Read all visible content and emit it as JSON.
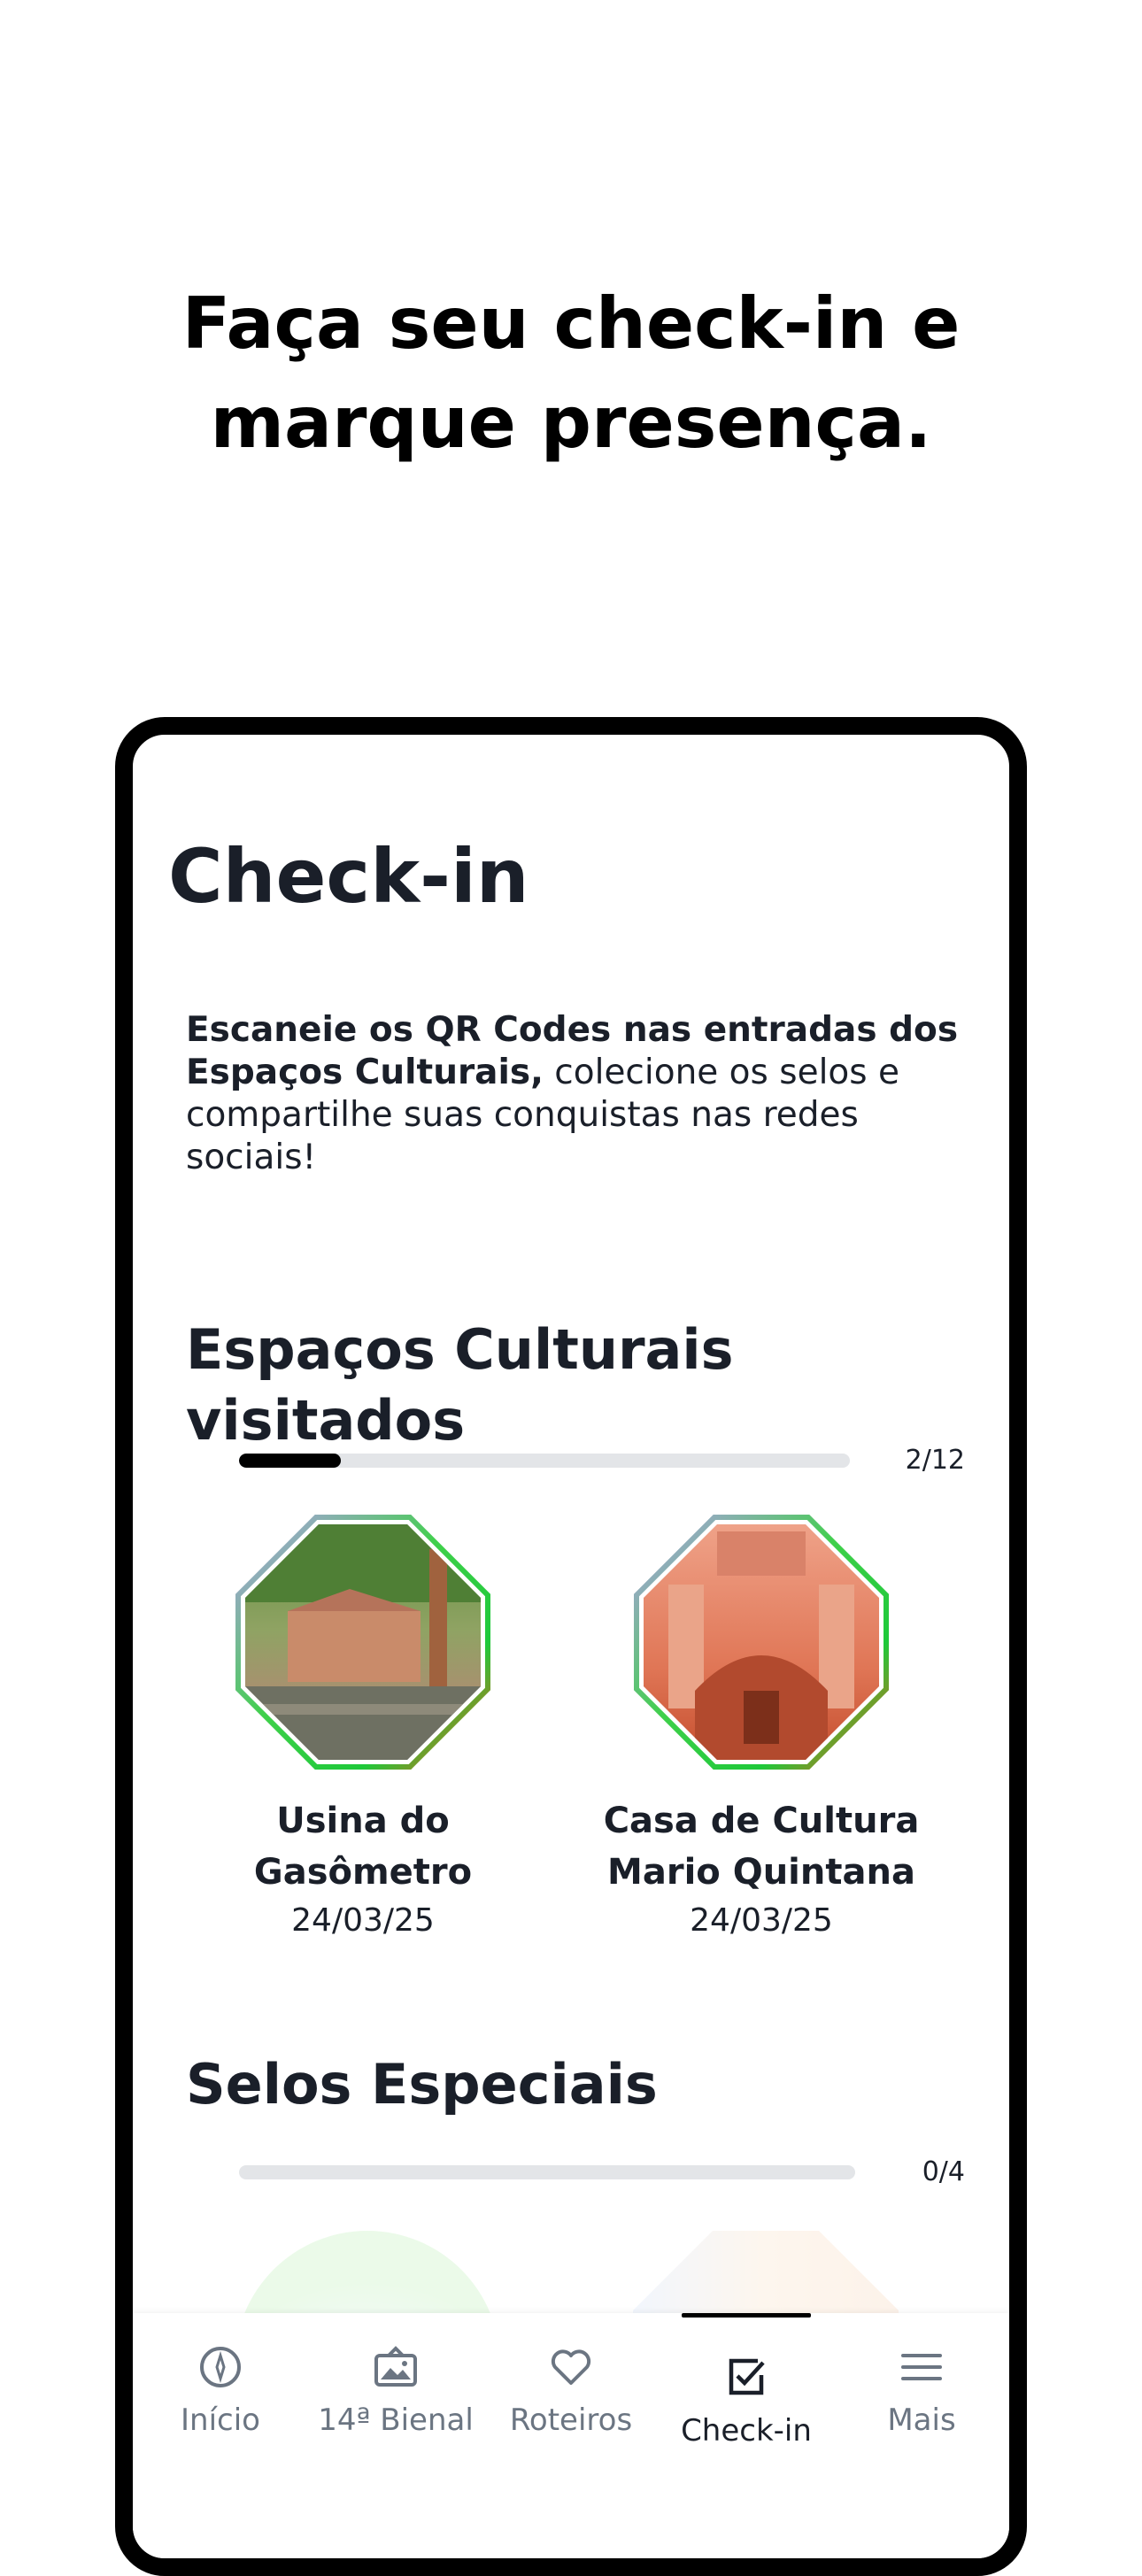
{
  "headline": {
    "line1": "Faça seu check-in e",
    "line2": "marque presença."
  },
  "screen": {
    "title": "Check-in",
    "intro_bold": "Escaneie os QR Codes nas entradas dos Espaços Culturais,",
    "intro_rest": " colecione os selos e compartilhe suas conquistas nas redes sociais!"
  },
  "visited": {
    "title": "Espaços Culturais visitados",
    "progress_count": "2/12",
    "progress_fraction": 0.1667,
    "items": [
      {
        "name_line1": "Usina do",
        "name_line2": "Gasômetro",
        "date": "24/03/25",
        "icon": "usina-photo-badge"
      },
      {
        "name_line1": "Casa de Cultura",
        "name_line2": "Mario Quintana",
        "date": "24/03/25",
        "icon": "casa-cultura-photo-badge"
      }
    ]
  },
  "special": {
    "title": "Selos Especiais",
    "progress_count": "0/4",
    "progress_fraction": 0
  },
  "tabbar": {
    "tabs": [
      {
        "label": "Início",
        "icon": "compass-icon"
      },
      {
        "label": "14ª Bienal",
        "icon": "gallery-icon"
      },
      {
        "label": "Roteiros",
        "icon": "heart-icon"
      },
      {
        "label": "Check-in",
        "icon": "checkbox-icon",
        "active": true
      },
      {
        "label": "Mais",
        "icon": "menu-icon"
      }
    ]
  },
  "colors": {
    "text": "#1a1f29",
    "muted": "#6b7582",
    "track": "#e3e5e8",
    "accent": "#000000"
  }
}
